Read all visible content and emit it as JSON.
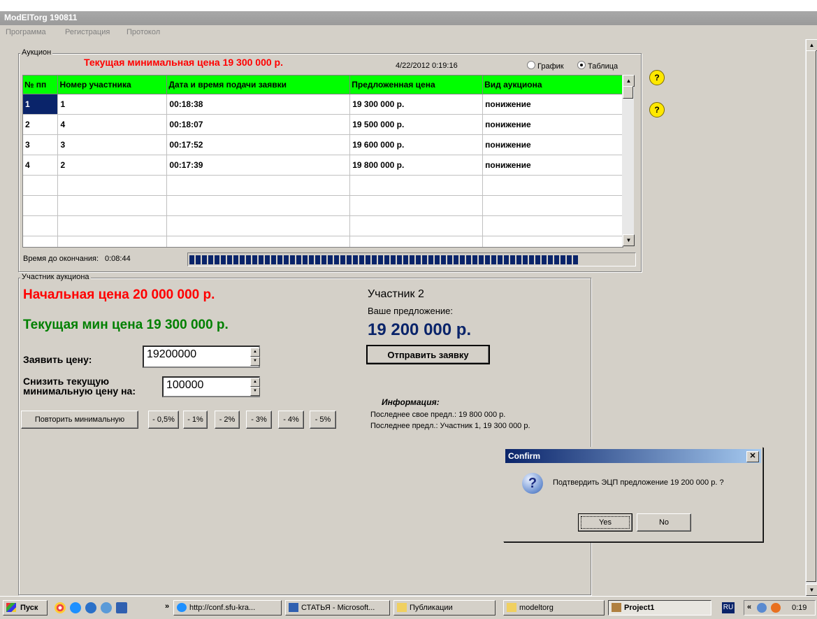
{
  "window": {
    "title": "ModElTorg 190811"
  },
  "menu": [
    "Программа",
    "Регистрация",
    "Протокол"
  ],
  "auction": {
    "legend": "Аукцион",
    "current_min_price": "Текущая минимальная цена 19 300 000 р.",
    "timestamp": "4/22/2012 0:19:16",
    "view_options": [
      "График",
      "Таблица"
    ],
    "selected_view": "Таблица",
    "columns": [
      "№ пп",
      "Номер участника",
      "Дата и время подачи заявки",
      "Предложенная цена",
      "Вид аукциона"
    ],
    "rows": [
      [
        "1",
        "1",
        "00:18:38",
        "19 300 000 р.",
        "понижение"
      ],
      [
        "2",
        "4",
        "00:18:07",
        "19 500 000 р.",
        "понижение"
      ],
      [
        "3",
        "3",
        "00:17:52",
        "19 600 000 р.",
        "понижение"
      ],
      [
        "4",
        "2",
        "00:17:39",
        "19 800 000 р.",
        "понижение"
      ]
    ],
    "time_left_label": "Время до окончания:",
    "time_left": "0:08:44",
    "time_progress_fraction": 0.88
  },
  "participant": {
    "legend": "Участник аукциона",
    "start_price": "Начальная цена 20 000 000 р.",
    "current_min": "Текущая мин цена 19 300 000 р.",
    "bid_label": "Заявить цену:",
    "bid_value": "19200000",
    "decrease_label_1": "Снизить текущую",
    "decrease_label_2": "минимальную цену на:",
    "decrease_value": "100000",
    "repeat_min_label": "Повторить минимальную",
    "percent_buttons": [
      "- 0,5%",
      "- 1%",
      "- 2%",
      "- 3%",
      "- 4%",
      "- 5%"
    ],
    "name": "Участник 2",
    "offer_label": "Ваше предложение:",
    "offer_value": "19 200 000 р.",
    "send_label": "Отправить заявку",
    "info_title": "Информация:",
    "info_own": "Последнее свое предл.: 19 800 000 р.",
    "info_last": "Последнее предл.: Участник 1, 19 300 000 р."
  },
  "dialog": {
    "title": "Confirm",
    "message": "Подтвердить ЭЦП предложение 19 200 000 р. ?",
    "yes": "Yes",
    "no": "No"
  },
  "taskbar": {
    "start": "Пуск",
    "chevron": "»",
    "items": [
      "http://conf.sfu-kra...",
      "СТАТЬЯ - Microsoft...",
      "Публикации",
      "modeltorg",
      "Project1"
    ],
    "lang": "RU",
    "tray_chevron": "«",
    "clock": "0:19"
  },
  "colors": {
    "header_green": "#00ff00",
    "red_text": "#ff0000",
    "green_text": "#008000",
    "navy": "#0a246a"
  }
}
